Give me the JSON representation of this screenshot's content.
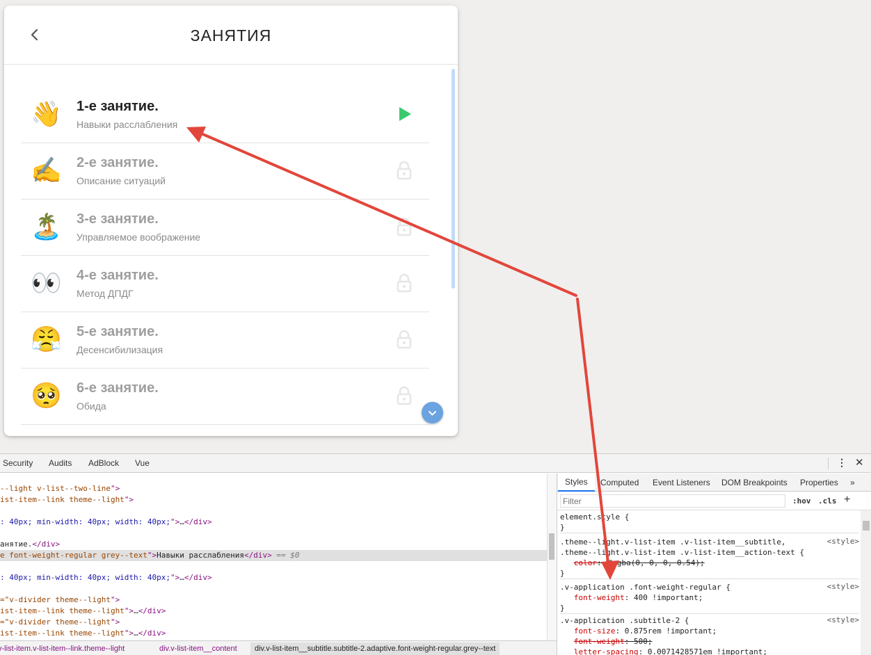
{
  "app": {
    "title": "ЗАНЯТИЯ",
    "lessons": [
      {
        "emoji": "👋",
        "title": "1-е занятие.",
        "subtitle": "Навыки расслабления",
        "status": "play",
        "active": true
      },
      {
        "emoji": "✍️",
        "title": "2-е занятие.",
        "subtitle": "Описание ситуаций",
        "status": "locked",
        "active": false
      },
      {
        "emoji": "🏝️",
        "title": "3-е занятие.",
        "subtitle": "Управляемое воображение",
        "status": "locked",
        "active": false
      },
      {
        "emoji": "👀",
        "title": "4-е занятие.",
        "subtitle": "Метод ДПДГ",
        "status": "locked",
        "active": false
      },
      {
        "emoji": "😤",
        "title": "5-е занятие.",
        "subtitle": "Десенсибилизация",
        "status": "locked",
        "active": false
      },
      {
        "emoji": "🥺",
        "title": "6-е занятие.",
        "subtitle": "Обида",
        "status": "locked",
        "active": false
      }
    ],
    "colors": {
      "play": "#3cc86e",
      "lock": "#e6e6e6",
      "fab": "#6aa3e0",
      "arrow": "#e2463b"
    }
  },
  "devtools": {
    "tabs": [
      "Security",
      "Audits",
      "AdBlock",
      "Vue"
    ],
    "elements_lines": [
      {
        "parts": [
          [
            "attr",
            "--light v-list--two-line"
          ],
          [
            "tag",
            "\">"
          ]
        ]
      },
      {
        "parts": [
          [
            "attr",
            "ist-item--link theme--light"
          ],
          [
            "tag",
            "\">"
          ]
        ]
      },
      {
        "parts": []
      },
      {
        "parts": [
          [
            "val",
            ": 40px; min-width: 40px; width: 40px;"
          ],
          [
            "tag",
            "\">"
          ],
          [
            "ellip",
            "…"
          ],
          [
            "tag",
            "</div>"
          ]
        ]
      },
      {
        "parts": []
      },
      {
        "parts": [
          [
            "txt",
            "анятие."
          ],
          [
            "tag",
            "</div>"
          ]
        ]
      },
      {
        "parts": [
          [
            "attr",
            "e font-weight-regular grey--text"
          ],
          [
            "tag",
            "\">"
          ],
          [
            "txt",
            "Навыки расслабления"
          ],
          [
            "tag",
            "</div>"
          ],
          [
            "dollar",
            " == $0"
          ]
        ],
        "selected": true
      },
      {
        "parts": []
      },
      {
        "parts": [
          [
            "val",
            ": 40px; min-width: 40px; width: 40px;"
          ],
          [
            "tag",
            "\">"
          ],
          [
            "ellip",
            "…"
          ],
          [
            "tag",
            "</div>"
          ]
        ]
      },
      {
        "parts": []
      },
      {
        "parts": [
          [
            "attr",
            "=\"v-divider theme--light"
          ],
          [
            "tag",
            "\">"
          ]
        ]
      },
      {
        "parts": [
          [
            "attr",
            "ist-item--link theme--light"
          ],
          [
            "tag",
            "\">"
          ],
          [
            "ellip",
            "…"
          ],
          [
            "tag",
            "</div>"
          ]
        ]
      },
      {
        "parts": [
          [
            "attr",
            "=\"v-divider theme--light"
          ],
          [
            "tag",
            "\">"
          ]
        ]
      },
      {
        "parts": [
          [
            "attr",
            "ist-item--link theme--light"
          ],
          [
            "tag",
            "\">"
          ],
          [
            "ellip",
            "…"
          ],
          [
            "tag",
            "</div>"
          ]
        ]
      }
    ],
    "breadcrumbs": [
      "v-list-item.v-list-item--link.theme--light",
      "div.v-list-item__content",
      "div.v-list-item__subtitle.subtitle-2.adaptive.font-weight-regular.grey--text"
    ],
    "styles_tabs": [
      "Styles",
      "Computed",
      "Event Listeners",
      "DOM Breakpoints",
      "Properties",
      "»"
    ],
    "filter_placeholder": "Filter",
    "hov": ":hov",
    "cls": ".cls",
    "rules": [
      {
        "lines": [
          "element.style {",
          "}"
        ],
        "source": ""
      },
      {
        "lines": [
          ".theme--light.v-list-item .v-list-item__subtitle,",
          ".theme--light.v-list-item .v-list-item__action-text {"
        ],
        "props": [
          {
            "name": "color",
            "value": "rgba(0, 0, 0, 0.54);",
            "strike": true,
            "swatch": true
          }
        ],
        "close": "}",
        "source": "<style>"
      },
      {
        "lines": [
          ".v-application .font-weight-regular {"
        ],
        "props": [
          {
            "name": "font-weight",
            "value": "400 !important;",
            "strike": false
          }
        ],
        "close": "}",
        "source": "<style>"
      },
      {
        "lines": [
          ".v-application .subtitle-2 {"
        ],
        "props": [
          {
            "name": "font-size",
            "value": "0.875rem !important;",
            "strike": false
          },
          {
            "name": "font-weight",
            "value": "500;",
            "strike": true
          },
          {
            "name": "letter-spacing",
            "value": "0.0071428571em !important;",
            "strike": false
          }
        ],
        "close": "",
        "source": "<style>"
      }
    ]
  }
}
